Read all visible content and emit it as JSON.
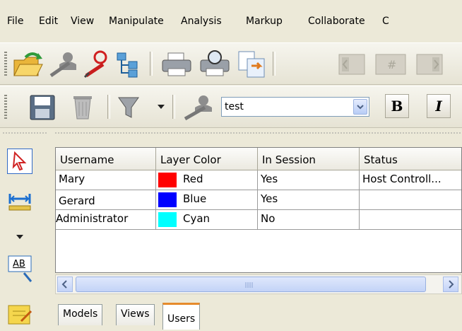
{
  "menu": [
    "File",
    "Edit",
    "View",
    "Manipulate",
    "Analysis",
    "Markup",
    "Collaborate",
    "C"
  ],
  "toolbar1": {
    "icons": [
      "open-folder-icon",
      "add-user-icon",
      "pen-user-icon",
      "hierarchy-icon",
      "print-icon",
      "print-preview-icon",
      "copy-icon",
      "nav-left-icon",
      "page-number-icon",
      "nav-right-icon"
    ]
  },
  "toolbar2": {
    "combo_value": "test",
    "bold_label": "B",
    "italic_label": "I"
  },
  "palette": {
    "text_tool_label": "AB"
  },
  "grid": {
    "columns": [
      "Username",
      "Layer Color",
      "In Session",
      "Status"
    ],
    "rows": [
      {
        "username": "Mary",
        "color_name": "Red",
        "color": "#ff0000",
        "in_session": "Yes",
        "status": "Host Controll..."
      },
      {
        "username": "Gerard",
        "color_name": "Blue",
        "color": "#0000ff",
        "in_session": "Yes",
        "status": ""
      },
      {
        "username": "Administrator",
        "color_name": "Cyan",
        "color": "#00ffff",
        "in_session": "No",
        "status": ""
      }
    ]
  },
  "tabs": [
    "Models",
    "Views",
    "Users"
  ],
  "active_tab": "Users"
}
